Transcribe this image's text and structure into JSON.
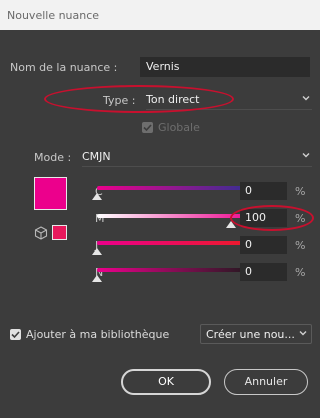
{
  "window": {
    "title": "Nouvelle nuance"
  },
  "name": {
    "label": "Nom de la nuance :",
    "value": "Vernis"
  },
  "type": {
    "label": "Type :",
    "value": "Ton direct"
  },
  "global": {
    "label": "Globale",
    "checked": true,
    "disabled": true
  },
  "mode": {
    "label": "Mode :",
    "value": "CMJN"
  },
  "swatch": {
    "color": "#ec008c",
    "preview_color": "#e8185c"
  },
  "channels": [
    {
      "label": "C",
      "value": "0",
      "unit": "%",
      "fraction": 0.0
    },
    {
      "label": "M",
      "value": "100",
      "unit": "%",
      "fraction": 1.0
    },
    {
      "label": "J",
      "value": "0",
      "unit": "%",
      "fraction": 0.0
    },
    {
      "label": "N",
      "value": "0",
      "unit": "%",
      "fraction": 0.0
    }
  ],
  "library": {
    "label": "Ajouter à ma bibliothèque",
    "checked": true,
    "dropdown_value": "Créer une nou..."
  },
  "buttons": {
    "ok": "OK",
    "cancel": "Annuler"
  },
  "colors": {
    "annotation": "#c8102e",
    "accent": "#ec008c"
  }
}
